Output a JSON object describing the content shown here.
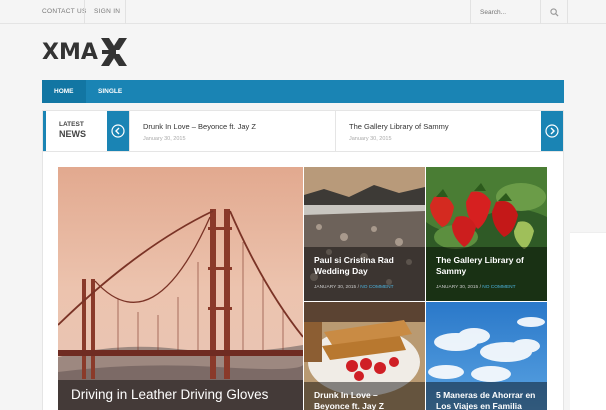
{
  "topbar": {
    "contact_label": "CONTACT US",
    "signin_label": "SIGN IN",
    "search_placeholder": "Search..."
  },
  "logo": {
    "text": "XMA",
    "mark": "X"
  },
  "nav": {
    "items": [
      {
        "label": "HOME"
      },
      {
        "label": "SINGLE"
      }
    ]
  },
  "ticker": {
    "label_line1": "LATEST",
    "label_line2": "NEWS",
    "items": [
      {
        "title": "Drunk In Love – Beyonce ft. Jay Z",
        "date": "January 30, 2015"
      },
      {
        "title": "The Gallery Library of Sammy",
        "date": "January 30, 2015"
      }
    ]
  },
  "featured": {
    "main": {
      "title": "Driving in Leather Driving Gloves"
    },
    "tiles": [
      {
        "title": "Paul si Cristina Rad Wedding Day",
        "date": "JANUARY 30, 2015",
        "comments": "NO COMMENT"
      },
      {
        "title": "The Gallery Library of Sammy",
        "date": "JANUARY 30, 2015",
        "comments": "NO COMMENT"
      },
      {
        "title": "Drunk In Love – Beyonce ft. Jay Z"
      },
      {
        "title": "5 Maneras de Ahorrar en Los Viajes en Familia"
      }
    ]
  },
  "colors": {
    "accent": "#1a84b4",
    "accent_dark": "#1276a3",
    "comment_link": "#4db4e0"
  }
}
